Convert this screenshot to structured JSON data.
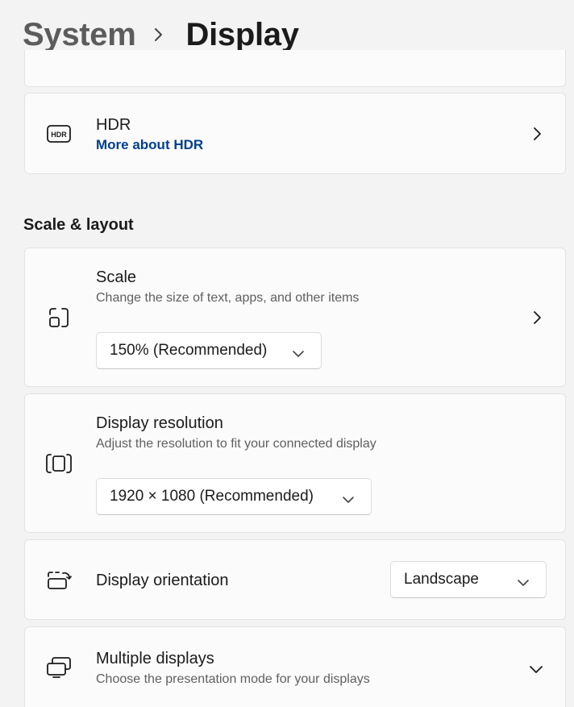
{
  "breadcrumb": {
    "parent": "System",
    "current": "Display"
  },
  "hdr": {
    "title": "HDR",
    "link": "More about HDR",
    "icon": "hdr-icon"
  },
  "section": {
    "title": "Scale & layout"
  },
  "scale": {
    "title": "Scale",
    "subtitle": "Change the size of text, apps, and other items",
    "value": "150% (Recommended)",
    "icon": "scale-icon"
  },
  "resolution": {
    "title": "Display resolution",
    "subtitle": "Adjust the resolution to fit your connected display",
    "value": "1920 × 1080 (Recommended)",
    "icon": "resolution-icon"
  },
  "orientation": {
    "title": "Display orientation",
    "value": "Landscape",
    "icon": "orientation-icon"
  },
  "multiple": {
    "title": "Multiple displays",
    "subtitle": "Choose the presentation mode for your displays",
    "icon": "multiple-displays-icon"
  },
  "colors": {
    "background": "#f3f3f3",
    "card": "#fbfbfb",
    "link": "#003e92"
  }
}
